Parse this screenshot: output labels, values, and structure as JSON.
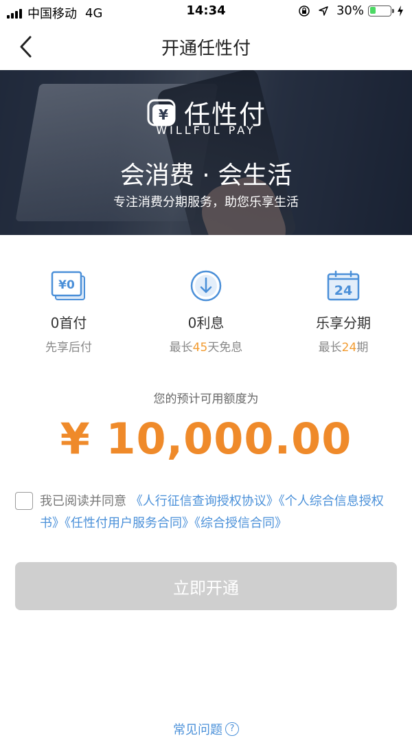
{
  "status_bar": {
    "carrier": "中国移动",
    "network": "4G",
    "time": "14:34",
    "battery": "30%",
    "battery_level": 0.3
  },
  "nav": {
    "title": "开通任性付"
  },
  "banner": {
    "logo_text": "任性付",
    "logo_icon_glyph": "¥",
    "logo_sub": "WILLFUL PAY",
    "slogan": "会消费 · 会生活",
    "description": "专注消费分期服务，助您乐享生活"
  },
  "features": [
    {
      "icon": "zero-yen-card-icon",
      "icon_text": "¥0",
      "title": "0首付",
      "sub_pre": "先享后付",
      "sub_highlight": "",
      "sub_post": ""
    },
    {
      "icon": "down-arrow-circle-icon",
      "title": "0利息",
      "sub_pre": "最长",
      "sub_highlight": "45",
      "sub_post": "天免息"
    },
    {
      "icon": "calendar-24-icon",
      "icon_text": "24",
      "title": "乐享分期",
      "sub_pre": "最长",
      "sub_highlight": "24",
      "sub_post": "期"
    }
  ],
  "credit": {
    "label": "您的预计可用额度为",
    "amount": "¥ 10,000.00"
  },
  "agreement": {
    "prefix": "我已阅读并同意",
    "links": [
      "《人行征信查询授权协议》",
      "《个人综合信息授权书》",
      "《任性付用户服务合同》",
      "《综合授信合同》"
    ]
  },
  "button": {
    "label": "立即开通"
  },
  "faq": {
    "label": "常见问题",
    "icon_glyph": "?"
  },
  "colors": {
    "accent": "#ef8a2a",
    "link": "#4a90d9",
    "icon_blue": "#4a8fd8",
    "button_disabled": "#cfcfcf"
  }
}
